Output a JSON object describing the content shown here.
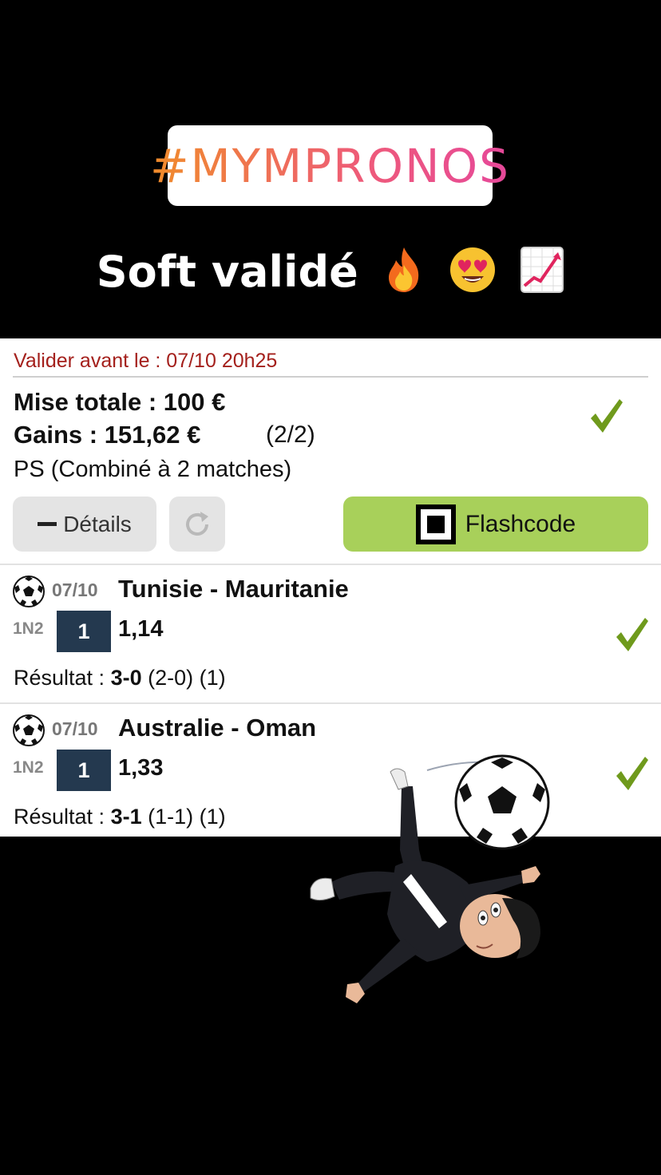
{
  "story": {
    "hashtag": "#MYMPRONOS",
    "caption": "Soft validé",
    "caption_emojis": [
      "fire-emoji",
      "heart-eyes-emoji",
      "chart-increasing-emoji"
    ]
  },
  "ticket": {
    "deadline": "Valider avant le : 07/10 20h25",
    "mise": "Mise totale : 100 €",
    "gains": "Gains : 151,62 €",
    "count": "(2/2)",
    "bet_type": "PS (Combiné à 2 matches)",
    "details_label": "Détails",
    "flashcode_label": "Flashcode",
    "status": "validated"
  },
  "matches": [
    {
      "date": "07/10",
      "teams": "Tunisie - Mauritanie",
      "market": "1N2",
      "pick": "1",
      "odds": "1,14",
      "result_label": "Résultat : ",
      "score": "3-0",
      "detail": " (2-0) (1)"
    },
    {
      "date": "07/10",
      "teams": "Australie - Oman",
      "market": "1N2",
      "pick": "1",
      "odds": "1,33",
      "result_label": "Résultat : ",
      "score": "3-1",
      "detail": " (1-1) (1)"
    }
  ],
  "colors": {
    "deadline": "#a4201c",
    "check": "#6f9a1c",
    "flashcode_bg": "#a8d05a",
    "pick_bg": "#24394f"
  }
}
